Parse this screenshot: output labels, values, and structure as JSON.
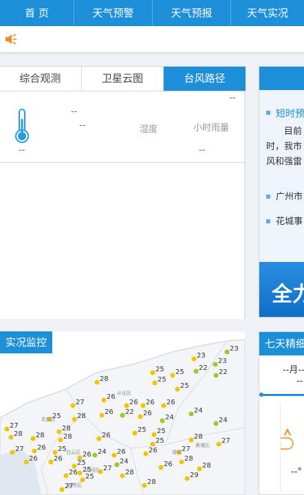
{
  "nav": {
    "items": [
      "首 页",
      "天气预警",
      "天气预报",
      "天气实况"
    ]
  },
  "alert": {
    "icon": "speaker-icon"
  },
  "tabs": [
    "综合观测",
    "卫星云图",
    "台风路径"
  ],
  "observation": {
    "temp": "--",
    "top_dash": "--",
    "mid_dash": "--",
    "humidity_label": "湿度",
    "rain_label": "小时雨量",
    "rain_value": "--",
    "corner_dash": "--"
  },
  "forecast_panel": {
    "title": "短时预",
    "lines": [
      "目前",
      "时，我市",
      "风和强雷"
    ],
    "links": [
      "广州市",
      "花城事"
    ],
    "banner": "全力"
  },
  "monitor": {
    "title": "实况监控",
    "stations": [
      {
        "v": "23"
      },
      {
        "v": "23"
      },
      {
        "v": "25"
      },
      {
        "v": "23"
      },
      {
        "v": "28"
      },
      {
        "v": "25"
      },
      {
        "v": "25"
      },
      {
        "v": "22"
      },
      {
        "v": "22"
      },
      {
        "v": "25"
      },
      {
        "v": "27"
      },
      {
        "v": "26"
      },
      {
        "v": "26"
      },
      {
        "v": "26"
      },
      {
        "v": "26"
      },
      {
        "v": "25"
      },
      {
        "v": "28"
      },
      {
        "v": "26"
      },
      {
        "v": "22"
      },
      {
        "v": "26"
      },
      {
        "v": "24"
      },
      {
        "v": "24"
      },
      {
        "v": "24"
      },
      {
        "v": "27"
      },
      {
        "v": "28"
      },
      {
        "v": "28"
      },
      {
        "v": "28"
      },
      {
        "v": "28"
      },
      {
        "v": "26"
      },
      {
        "v": "25"
      },
      {
        "v": "25"
      },
      {
        "v": "25"
      },
      {
        "v": "28"
      },
      {
        "v": "27"
      },
      {
        "v": "27"
      },
      {
        "v": "26"
      },
      {
        "v": "24"
      },
      {
        "v": "26"
      },
      {
        "v": "26"
      },
      {
        "v": "25"
      },
      {
        "v": "26"
      },
      {
        "v": "26"
      },
      {
        "v": "26"
      },
      {
        "v": "25"
      },
      {
        "v": "24"
      },
      {
        "v": "26"
      },
      {
        "v": "27"
      },
      {
        "v": "28"
      },
      {
        "v": "25"
      },
      {
        "v": "27"
      },
      {
        "v": "28"
      },
      {
        "v": "28"
      },
      {
        "v": "29"
      },
      {
        "v": "28"
      },
      {
        "v": "26"
      },
      {
        "v": "25"
      },
      {
        "v": "27"
      }
    ],
    "district_labels": [
      "从化区",
      "花都区",
      "白云区",
      "黄埔区",
      "增城",
      "天河区",
      "越秀区"
    ]
  },
  "seven_day": {
    "title": "七天精细",
    "date": "--月--",
    "dash1": "--",
    "temp_low": "--°"
  }
}
